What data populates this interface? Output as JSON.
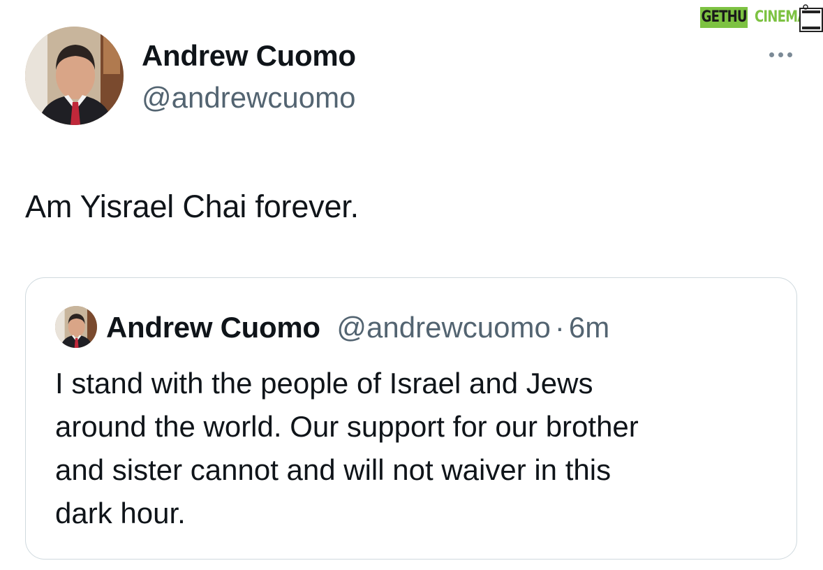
{
  "watermark": {
    "brand_part1": "GETHU",
    "brand_part2": "CINEMA",
    "accent_color": "#7dc242"
  },
  "tweet": {
    "author": {
      "name": "Andrew Cuomo",
      "handle": "@andrewcuomo"
    },
    "more_icon": "more-horizontal-icon",
    "text": "Am Yisrael Chai forever."
  },
  "quoted_tweet": {
    "author": {
      "name": "Andrew Cuomo",
      "handle": "@andrewcuomo"
    },
    "separator": "·",
    "time": "6m",
    "lines": [
      "I stand with the people of Israel and Jews",
      "around the world.  Our support for our brother",
      "and sister cannot and will not waiver in this",
      "dark hour."
    ]
  },
  "colors": {
    "text_primary": "#0f1419",
    "text_secondary": "#536471",
    "border": "#cfd9de"
  }
}
